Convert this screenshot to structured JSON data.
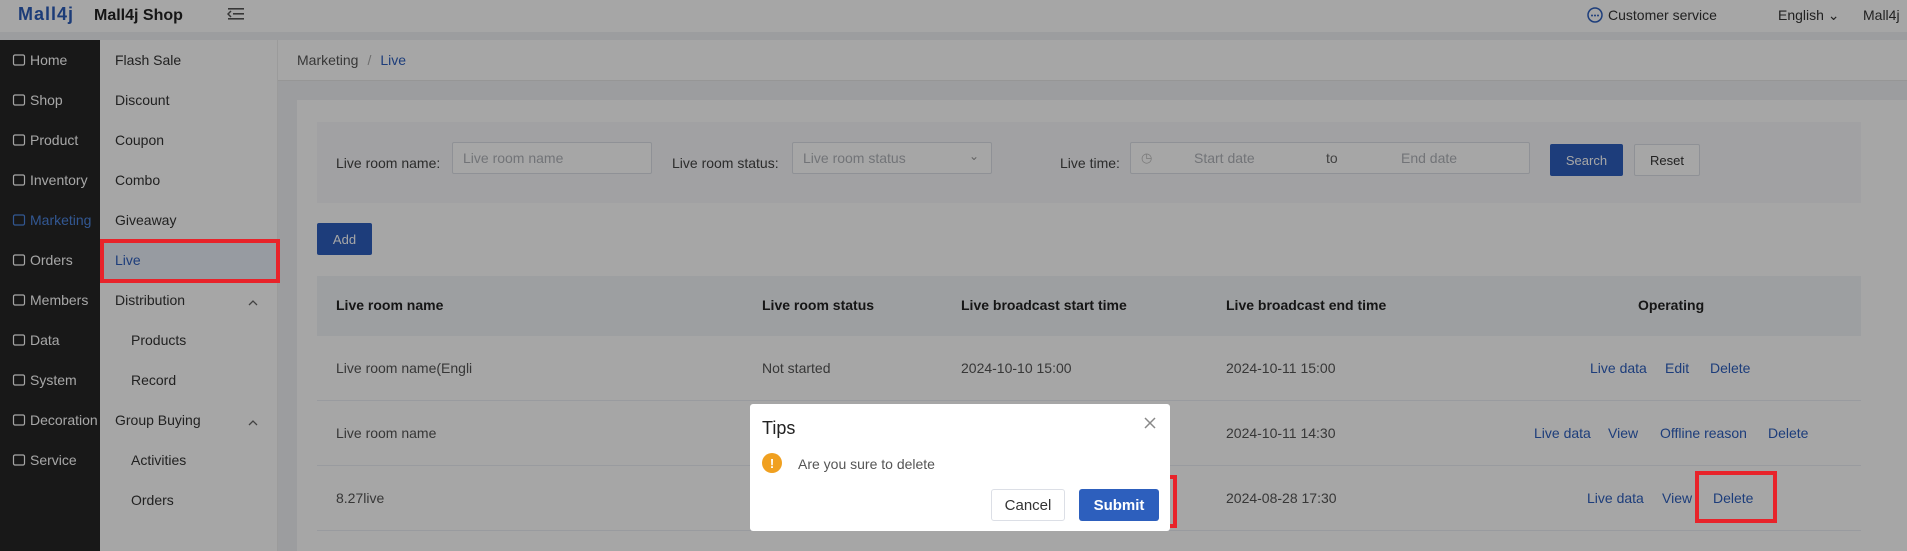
{
  "header": {
    "logo": "Mall4j",
    "shop_name": "Mall4j Shop",
    "customer_service": "Customer service",
    "language": "English",
    "user": "Mall4j"
  },
  "nav_main": [
    {
      "label": "Home",
      "icon": "home-icon"
    },
    {
      "label": "Shop",
      "icon": "shop-icon"
    },
    {
      "label": "Product",
      "icon": "product-icon"
    },
    {
      "label": "Inventory",
      "icon": "inventory-icon"
    },
    {
      "label": "Marketing",
      "icon": "gift-icon",
      "active": true
    },
    {
      "label": "Orders",
      "icon": "orders-icon"
    },
    {
      "label": "Members",
      "icon": "members-icon"
    },
    {
      "label": "Data",
      "icon": "data-icon"
    },
    {
      "label": "System",
      "icon": "gear-icon"
    },
    {
      "label": "Decoration",
      "icon": "palette-icon"
    },
    {
      "label": "Service",
      "icon": "chat-icon"
    }
  ],
  "nav_sub": [
    {
      "label": "Flash Sale"
    },
    {
      "label": "Discount"
    },
    {
      "label": "Coupon"
    },
    {
      "label": "Combo"
    },
    {
      "label": "Giveaway"
    },
    {
      "label": "Live",
      "active": true
    },
    {
      "label": "Distribution",
      "group": true
    },
    {
      "label": "Products",
      "child": true
    },
    {
      "label": "Record",
      "child": true
    },
    {
      "label": "Group Buying",
      "group": true
    },
    {
      "label": "Activities",
      "child": true
    },
    {
      "label": "Orders",
      "child": true
    }
  ],
  "breadcrumb": [
    "Marketing",
    "Live"
  ],
  "search": {
    "room_name_label": "Live room name:",
    "room_name_placeholder": "Live room name",
    "room_status_label": "Live room status:",
    "room_status_placeholder": "Live room status",
    "live_time_label": "Live time:",
    "start_placeholder": "Start date",
    "to": "to",
    "end_placeholder": "End date",
    "search_btn": "Search",
    "reset_btn": "Reset"
  },
  "add_btn": "Add",
  "table": {
    "headers": [
      "Live room name",
      "Live room status",
      "Live broadcast start time",
      "Live broadcast end time",
      "Operating"
    ],
    "rows": [
      {
        "name": "Live room name(Engli",
        "status": "Not started",
        "start": "2024-10-10 15:00",
        "end": "2024-10-11 15:00",
        "ops": [
          "Live data",
          "Edit",
          "Delete"
        ]
      },
      {
        "name": "Live room name",
        "status": "",
        "start": "",
        "end": "2024-10-11 14:30",
        "ops": [
          "Live data",
          "View",
          "Offline reason",
          "Delete"
        ]
      },
      {
        "name": "8.27live",
        "status": "",
        "start": "",
        "end": "2024-08-28 17:30",
        "ops": [
          "Live data",
          "View",
          "Delete"
        ]
      }
    ]
  },
  "dialog": {
    "title": "Tips",
    "message": "Are you sure to delete",
    "cancel": "Cancel",
    "submit": "Submit"
  },
  "colors": {
    "primary": "#2d5fbd",
    "highlight": "#e8232a",
    "warning": "#f0a020"
  }
}
